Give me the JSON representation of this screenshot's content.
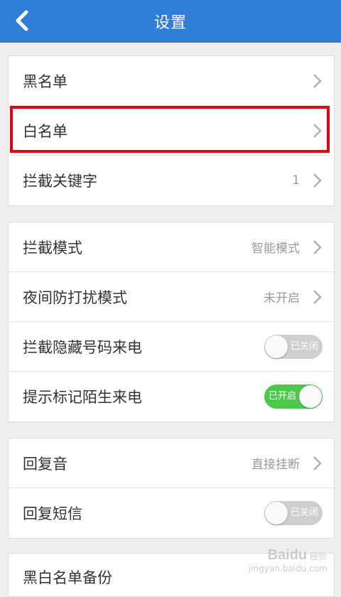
{
  "header": {
    "title": "设置",
    "back_icon": "chevron-left-icon"
  },
  "groups": [
    {
      "rows": [
        {
          "label": "黑名单",
          "value": "",
          "control": "chevron"
        },
        {
          "label": "白名单",
          "value": "",
          "control": "chevron",
          "highlighted": true
        },
        {
          "label": "拦截关键字",
          "value": "1",
          "control": "chevron"
        }
      ]
    },
    {
      "rows": [
        {
          "label": "拦截模式",
          "value": "智能模式",
          "control": "chevron"
        },
        {
          "label": "夜间防打扰模式",
          "value": "未开启",
          "control": "chevron"
        },
        {
          "label": "拦截隐藏号码来电",
          "control": "toggle",
          "toggle_state": "off",
          "toggle_text": "已关闭"
        },
        {
          "label": "提示标记陌生来电",
          "control": "toggle",
          "toggle_state": "on",
          "toggle_text": "已开启"
        }
      ]
    },
    {
      "rows": [
        {
          "label": "回复音",
          "value": "直接挂断",
          "control": "chevron"
        },
        {
          "label": "回复短信",
          "control": "toggle",
          "toggle_state": "off",
          "toggle_text": "已关闭"
        }
      ]
    },
    {
      "rows": [
        {
          "label": "黑白名单备份",
          "value": "",
          "control": "none"
        }
      ]
    }
  ],
  "colors": {
    "header": "#2f7ed7",
    "toggle_on": "#4cc94a",
    "toggle_off": "#cfcfcf",
    "highlight": "#e60012"
  },
  "watermark": {
    "brand": "Baidu",
    "text": "经验",
    "url": "jingyan.baidu.com"
  }
}
